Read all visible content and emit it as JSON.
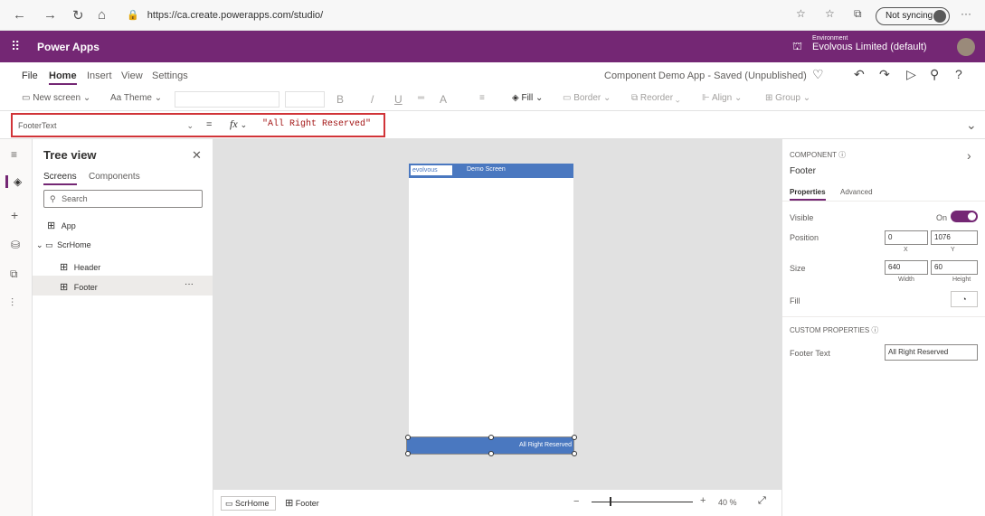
{
  "browser": {
    "url": "https://ca.create.powerapps.com/studio/",
    "sync_label": "Not syncing",
    "more": "···"
  },
  "app": {
    "name": "Power Apps",
    "env_label": "Environment",
    "env_value": "Evolvous Limited (default)"
  },
  "menu": {
    "items": [
      "File",
      "Home",
      "Insert",
      "View",
      "Settings"
    ],
    "saved_status": "Component Demo App - Saved (Unpublished)"
  },
  "ribbon": {
    "new_screen": "New screen",
    "theme": "Theme",
    "bold": "B",
    "italic": "/",
    "underline": "U",
    "fill": "Fill",
    "border": "Border",
    "reorder": "Reorder",
    "align": "Align",
    "group": "Group"
  },
  "formula": {
    "property": "FooterText",
    "equals": "=",
    "fx": "fx",
    "value": "\"All Right Reserved\""
  },
  "tree": {
    "title": "Tree view",
    "tabs": [
      "Screens",
      "Components"
    ],
    "search_placeholder": "Search",
    "app": "App",
    "screen": "ScrHome",
    "children": [
      "Header",
      "Footer"
    ],
    "more": "···"
  },
  "canvas": {
    "logo_text": "evolvous",
    "header_text": "Demo Screen",
    "footer_text": "All Right Reserved"
  },
  "bottombar": {
    "crumb_screen": "ScrHome",
    "crumb_component": "Footer",
    "zoom_minus": "−",
    "zoom_plus": "+",
    "zoom_value": "40 %",
    "zoom_level": 0.4
  },
  "props": {
    "section_label": "COMPONENT",
    "component_name": "Footer",
    "tabs": [
      "Properties",
      "Advanced"
    ],
    "visible_label": "Visible",
    "visible_value": "On",
    "position_label": "Position",
    "position_x": "0",
    "position_y": "1076",
    "x_label": "X",
    "y_label": "Y",
    "size_label": "Size",
    "width": "640",
    "height": "60",
    "width_label": "Width",
    "height_label": "Height",
    "fill_label": "Fill",
    "custom_label": "CUSTOM PROPERTIES",
    "footer_text_label": "Footer Text",
    "footer_text_value": "All Right Reserved"
  },
  "colors": {
    "brand": "#742774",
    "accent_blue": "#4a78c0",
    "highlight_red": "#d13438"
  }
}
